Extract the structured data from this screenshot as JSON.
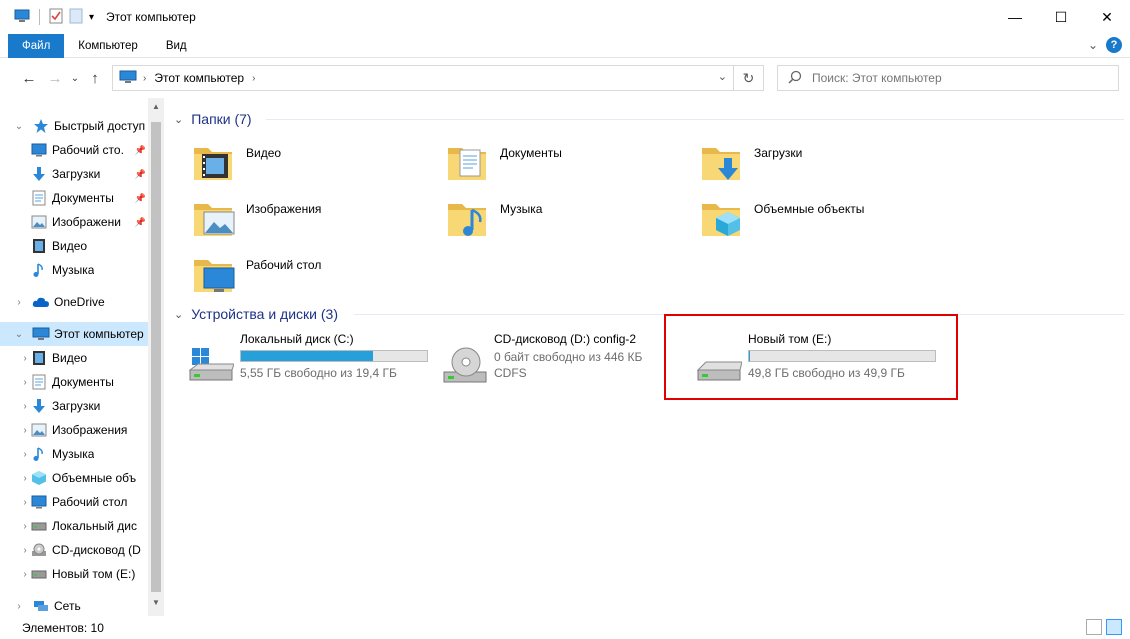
{
  "window": {
    "title": "Этот компьютер",
    "minimize": "—",
    "maximize": "☐",
    "close": "✕"
  },
  "ribbon": {
    "tabs": [
      "Файл",
      "Компьютер",
      "Вид"
    ],
    "expand": "⌄",
    "help": "?"
  },
  "address": {
    "path": "Этот компьютер",
    "separator": "›",
    "dropdown": "⌄",
    "refresh": "↻"
  },
  "search": {
    "placeholder": "Поиск: Этот компьютер"
  },
  "nav": {
    "back": "←",
    "forward": "→",
    "history": "⌄",
    "up": "↑"
  },
  "tree": [
    {
      "label": "Быстрый доступ",
      "icon": "star-icon",
      "arrow": "⌄",
      "level": 0,
      "pinned": false
    },
    {
      "label": "Рабочий сто.",
      "icon": "desktop-icon",
      "arrow": "",
      "level": 1,
      "pinned": true
    },
    {
      "label": "Загрузки",
      "icon": "download-icon",
      "arrow": "",
      "level": 1,
      "pinned": true
    },
    {
      "label": "Документы",
      "icon": "document-icon",
      "arrow": "",
      "level": 1,
      "pinned": true
    },
    {
      "label": "Изображени",
      "icon": "picture-icon",
      "arrow": "",
      "level": 1,
      "pinned": true
    },
    {
      "label": "Видео",
      "icon": "video-icon",
      "arrow": "",
      "level": 1,
      "pinned": false
    },
    {
      "label": "Музыка",
      "icon": "music-icon",
      "arrow": "",
      "level": 1,
      "pinned": false
    },
    {
      "label": "OneDrive",
      "icon": "cloud-icon",
      "arrow": "›",
      "level": 0,
      "pinned": false
    },
    {
      "label": "Этот компьютер",
      "icon": "computer-icon",
      "arrow": "⌄",
      "level": 0,
      "pinned": false
    },
    {
      "label": "Видео",
      "icon": "video-icon",
      "arrow": "›",
      "level": 1,
      "pinned": false
    },
    {
      "label": "Документы",
      "icon": "document-icon",
      "arrow": "›",
      "level": 1,
      "pinned": false
    },
    {
      "label": "Загрузки",
      "icon": "download-icon",
      "arrow": "›",
      "level": 1,
      "pinned": false
    },
    {
      "label": "Изображения",
      "icon": "picture-icon",
      "arrow": "›",
      "level": 1,
      "pinned": false
    },
    {
      "label": "Музыка",
      "icon": "music-icon",
      "arrow": "›",
      "level": 1,
      "pinned": false
    },
    {
      "label": "Объемные объ",
      "icon": "cube-icon",
      "arrow": "›",
      "level": 1,
      "pinned": false
    },
    {
      "label": "Рабочий стол",
      "icon": "desktop-icon",
      "arrow": "›",
      "level": 1,
      "pinned": false
    },
    {
      "label": "Локальный дис",
      "icon": "drive-icon",
      "arrow": "›",
      "level": 1,
      "pinned": false
    },
    {
      "label": "CD-дисковод (D",
      "icon": "cd-icon",
      "arrow": "›",
      "level": 1,
      "pinned": false
    },
    {
      "label": "Новый том (E:)",
      "icon": "drive-icon",
      "arrow": "›",
      "level": 1,
      "pinned": false
    },
    {
      "label": "Сеть",
      "icon": "network-icon",
      "arrow": "›",
      "level": 0,
      "pinned": false
    }
  ],
  "pin_glyph": "📌",
  "folders": {
    "header": "Папки (7)",
    "chevron": "⌄",
    "items": [
      {
        "label": "Видео",
        "overlay": "video"
      },
      {
        "label": "Документы",
        "overlay": "document"
      },
      {
        "label": "Загрузки",
        "overlay": "download"
      },
      {
        "label": "Изображения",
        "overlay": "picture"
      },
      {
        "label": "Музыка",
        "overlay": "music"
      },
      {
        "label": "Объемные объекты",
        "overlay": "cube"
      },
      {
        "label": "Рабочий стол",
        "overlay": "desktop"
      }
    ]
  },
  "devices": {
    "header": "Устройства и диски (3)",
    "chevron": "⌄",
    "items": [
      {
        "label": "Локальный диск (C:)",
        "type": "system",
        "used_fraction": 0.71,
        "info": "5,55 ГБ свободно из 19,4 ГБ",
        "info2": ""
      },
      {
        "label": "CD-дисковод (D:) config-2",
        "type": "cd",
        "used_fraction": null,
        "info": "0 байт свободно из 446 КБ",
        "info2": "CDFS"
      },
      {
        "label": "Новый том (E:)",
        "type": "drive",
        "used_fraction": 0.002,
        "info": "49,8 ГБ свободно из 49,9 ГБ",
        "info2": ""
      }
    ]
  },
  "status": {
    "count": "Элементов: 10"
  },
  "colors": {
    "accent": "#1979ca",
    "bar_fill": "#26a0da",
    "group_header": "#1e3287",
    "highlight": "#e00000",
    "selected": "#cce8ff"
  }
}
